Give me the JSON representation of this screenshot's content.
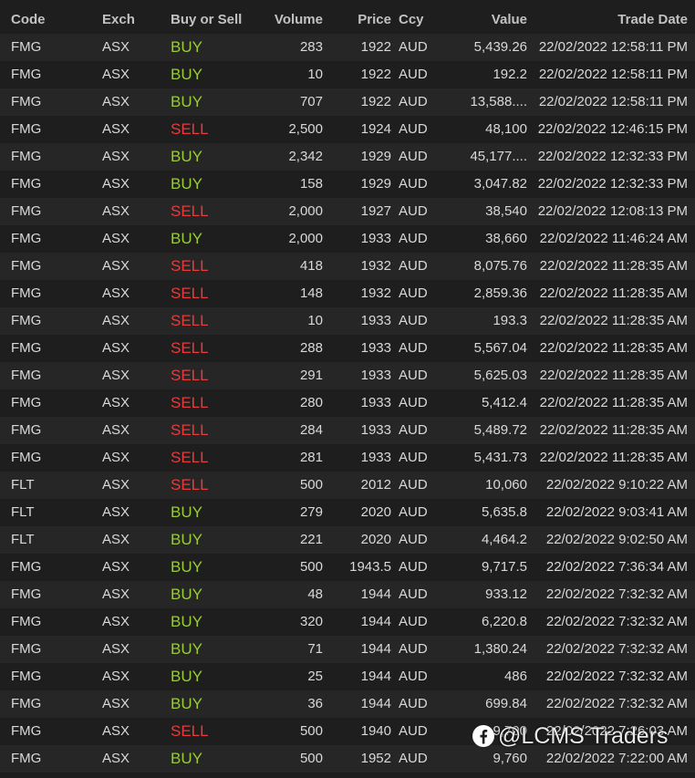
{
  "table": {
    "columns": {
      "code": "Code",
      "exch": "Exch",
      "side": "Buy or Sell",
      "volume": "Volume",
      "price": "Price",
      "ccy": "Ccy",
      "value": "Value",
      "trade_date": "Trade Date"
    },
    "rows": [
      {
        "code": "FMG",
        "exch": "ASX",
        "side": "BUY",
        "volume": "283",
        "price": "1922",
        "ccy": "AUD",
        "value": "5,439.26",
        "trade_date": "22/02/2022 12:58:11 PM"
      },
      {
        "code": "FMG",
        "exch": "ASX",
        "side": "BUY",
        "volume": "10",
        "price": "1922",
        "ccy": "AUD",
        "value": "192.2",
        "trade_date": "22/02/2022 12:58:11 PM"
      },
      {
        "code": "FMG",
        "exch": "ASX",
        "side": "BUY",
        "volume": "707",
        "price": "1922",
        "ccy": "AUD",
        "value": "13,588....",
        "trade_date": "22/02/2022 12:58:11 PM"
      },
      {
        "code": "FMG",
        "exch": "ASX",
        "side": "SELL",
        "volume": "2,500",
        "price": "1924",
        "ccy": "AUD",
        "value": "48,100",
        "trade_date": "22/02/2022 12:46:15 PM"
      },
      {
        "code": "FMG",
        "exch": "ASX",
        "side": "BUY",
        "volume": "2,342",
        "price": "1929",
        "ccy": "AUD",
        "value": "45,177....",
        "trade_date": "22/02/2022 12:32:33 PM"
      },
      {
        "code": "FMG",
        "exch": "ASX",
        "side": "BUY",
        "volume": "158",
        "price": "1929",
        "ccy": "AUD",
        "value": "3,047.82",
        "trade_date": "22/02/2022 12:32:33 PM"
      },
      {
        "code": "FMG",
        "exch": "ASX",
        "side": "SELL",
        "volume": "2,000",
        "price": "1927",
        "ccy": "AUD",
        "value": "38,540",
        "trade_date": "22/02/2022 12:08:13 PM"
      },
      {
        "code": "FMG",
        "exch": "ASX",
        "side": "BUY",
        "volume": "2,000",
        "price": "1933",
        "ccy": "AUD",
        "value": "38,660",
        "trade_date": "22/02/2022 11:46:24 AM"
      },
      {
        "code": "FMG",
        "exch": "ASX",
        "side": "SELL",
        "volume": "418",
        "price": "1932",
        "ccy": "AUD",
        "value": "8,075.76",
        "trade_date": "22/02/2022 11:28:35 AM"
      },
      {
        "code": "FMG",
        "exch": "ASX",
        "side": "SELL",
        "volume": "148",
        "price": "1932",
        "ccy": "AUD",
        "value": "2,859.36",
        "trade_date": "22/02/2022 11:28:35 AM"
      },
      {
        "code": "FMG",
        "exch": "ASX",
        "side": "SELL",
        "volume": "10",
        "price": "1933",
        "ccy": "AUD",
        "value": "193.3",
        "trade_date": "22/02/2022 11:28:35 AM"
      },
      {
        "code": "FMG",
        "exch": "ASX",
        "side": "SELL",
        "volume": "288",
        "price": "1933",
        "ccy": "AUD",
        "value": "5,567.04",
        "trade_date": "22/02/2022 11:28:35 AM"
      },
      {
        "code": "FMG",
        "exch": "ASX",
        "side": "SELL",
        "volume": "291",
        "price": "1933",
        "ccy": "AUD",
        "value": "5,625.03",
        "trade_date": "22/02/2022 11:28:35 AM"
      },
      {
        "code": "FMG",
        "exch": "ASX",
        "side": "SELL",
        "volume": "280",
        "price": "1933",
        "ccy": "AUD",
        "value": "5,412.4",
        "trade_date": "22/02/2022 11:28:35 AM"
      },
      {
        "code": "FMG",
        "exch": "ASX",
        "side": "SELL",
        "volume": "284",
        "price": "1933",
        "ccy": "AUD",
        "value": "5,489.72",
        "trade_date": "22/02/2022 11:28:35 AM"
      },
      {
        "code": "FMG",
        "exch": "ASX",
        "side": "SELL",
        "volume": "281",
        "price": "1933",
        "ccy": "AUD",
        "value": "5,431.73",
        "trade_date": "22/02/2022 11:28:35 AM"
      },
      {
        "code": "FLT",
        "exch": "ASX",
        "side": "SELL",
        "volume": "500",
        "price": "2012",
        "ccy": "AUD",
        "value": "10,060",
        "trade_date": "22/02/2022 9:10:22 AM"
      },
      {
        "code": "FLT",
        "exch": "ASX",
        "side": "BUY",
        "volume": "279",
        "price": "2020",
        "ccy": "AUD",
        "value": "5,635.8",
        "trade_date": "22/02/2022 9:03:41 AM"
      },
      {
        "code": "FLT",
        "exch": "ASX",
        "side": "BUY",
        "volume": "221",
        "price": "2020",
        "ccy": "AUD",
        "value": "4,464.2",
        "trade_date": "22/02/2022 9:02:50 AM"
      },
      {
        "code": "FMG",
        "exch": "ASX",
        "side": "BUY",
        "volume": "500",
        "price": "1943.5",
        "ccy": "AUD",
        "value": "9,717.5",
        "trade_date": "22/02/2022 7:36:34 AM"
      },
      {
        "code": "FMG",
        "exch": "ASX",
        "side": "BUY",
        "volume": "48",
        "price": "1944",
        "ccy": "AUD",
        "value": "933.12",
        "trade_date": "22/02/2022 7:32:32 AM"
      },
      {
        "code": "FMG",
        "exch": "ASX",
        "side": "BUY",
        "volume": "320",
        "price": "1944",
        "ccy": "AUD",
        "value": "6,220.8",
        "trade_date": "22/02/2022 7:32:32 AM"
      },
      {
        "code": "FMG",
        "exch": "ASX",
        "side": "BUY",
        "volume": "71",
        "price": "1944",
        "ccy": "AUD",
        "value": "1,380.24",
        "trade_date": "22/02/2022 7:32:32 AM"
      },
      {
        "code": "FMG",
        "exch": "ASX",
        "side": "BUY",
        "volume": "25",
        "price": "1944",
        "ccy": "AUD",
        "value": "486",
        "trade_date": "22/02/2022 7:32:32 AM"
      },
      {
        "code": "FMG",
        "exch": "ASX",
        "side": "BUY",
        "volume": "36",
        "price": "1944",
        "ccy": "AUD",
        "value": "699.84",
        "trade_date": "22/02/2022 7:32:32 AM"
      },
      {
        "code": "FMG",
        "exch": "ASX",
        "side": "SELL",
        "volume": "500",
        "price": "1940",
        "ccy": "AUD",
        "value": "9,700",
        "trade_date": "22/02/2022 7:26:03 AM"
      },
      {
        "code": "FMG",
        "exch": "ASX",
        "side": "BUY",
        "volume": "500",
        "price": "1952",
        "ccy": "AUD",
        "value": "9,760",
        "trade_date": "22/02/2022 7:22:00 AM"
      }
    ]
  },
  "watermark": {
    "icon": "facebook-icon",
    "text": "@LCMS Traders"
  },
  "colors": {
    "background": "#1e1e1e",
    "row_alt": "#262626",
    "buy": "#9acd32",
    "sell": "#e83b3b",
    "text": "#d9d9d9"
  }
}
